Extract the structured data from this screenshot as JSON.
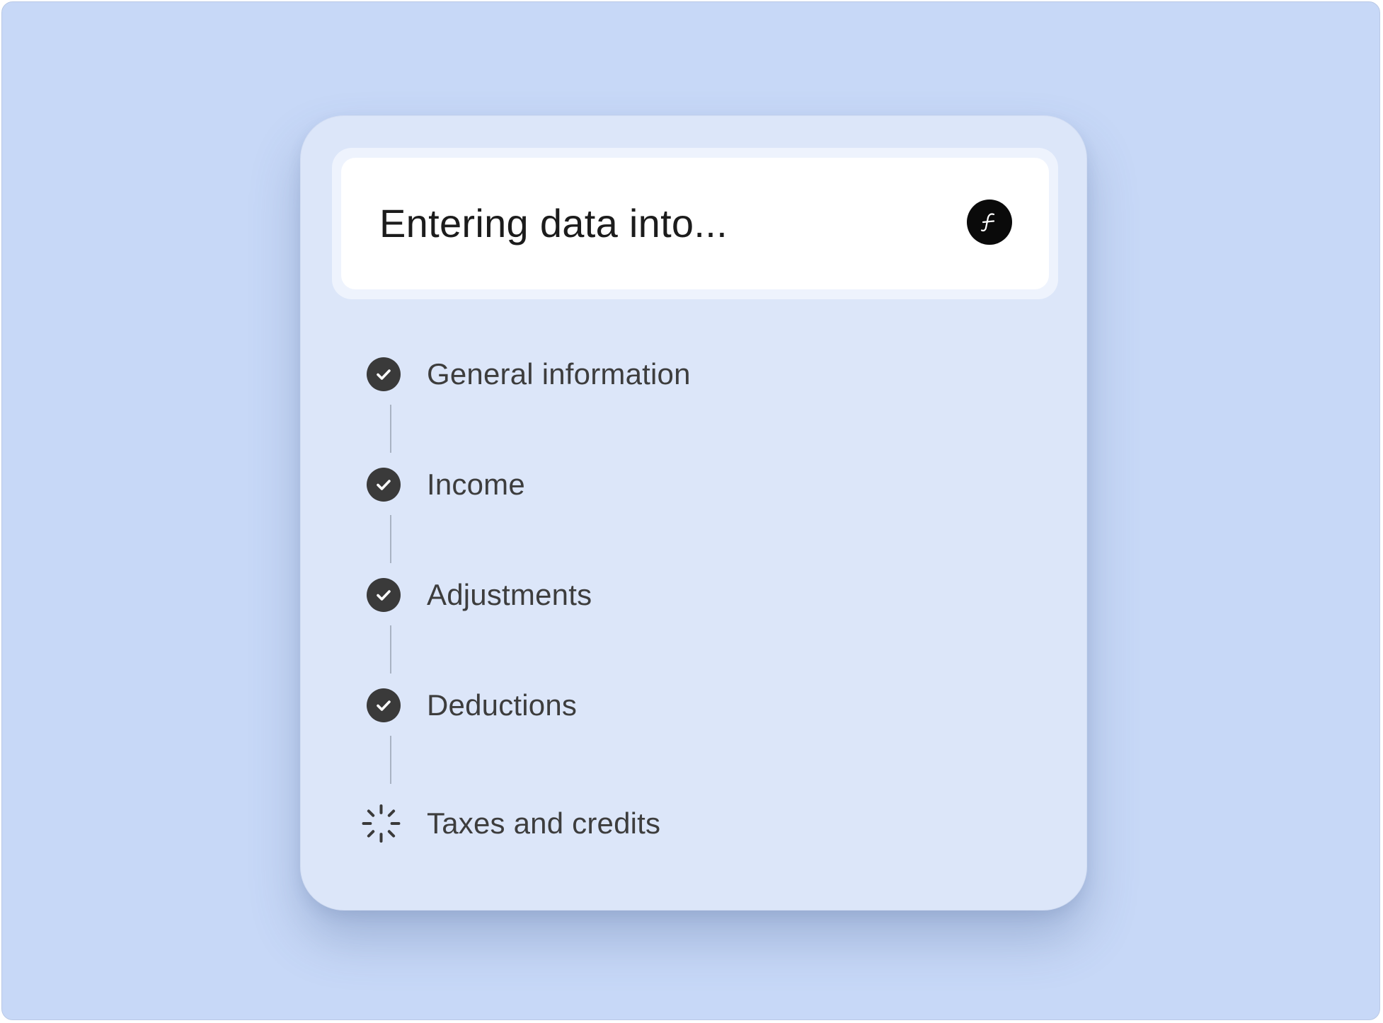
{
  "header": {
    "title": "Entering data into...",
    "logo_icon": "f-logo-icon"
  },
  "steps": [
    {
      "label": "General information",
      "status": "completed",
      "icon": "check-circle-icon"
    },
    {
      "label": "Income",
      "status": "completed",
      "icon": "check-circle-icon"
    },
    {
      "label": "Adjustments",
      "status": "completed",
      "icon": "check-circle-icon"
    },
    {
      "label": "Deductions",
      "status": "completed",
      "icon": "check-circle-icon"
    },
    {
      "label": "Taxes and credits",
      "status": "in-progress",
      "icon": "loading-spinner-icon"
    }
  ],
  "colors": {
    "background": "#c7d8f7",
    "card": "#dce6f9",
    "check": "#3a3a3a",
    "logo": "#0a0a0a"
  }
}
